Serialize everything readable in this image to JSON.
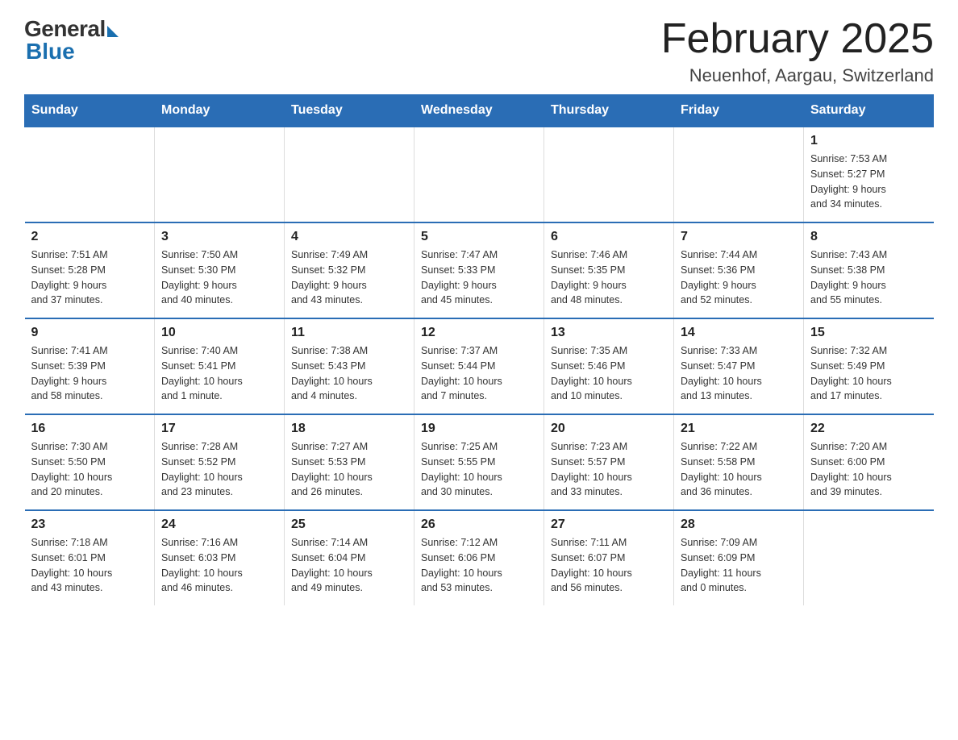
{
  "logo": {
    "general": "General",
    "blue": "Blue"
  },
  "title": "February 2025",
  "subtitle": "Neuenhof, Aargau, Switzerland",
  "days_of_week": [
    "Sunday",
    "Monday",
    "Tuesday",
    "Wednesday",
    "Thursday",
    "Friday",
    "Saturday"
  ],
  "weeks": [
    [
      {
        "day": "",
        "info": ""
      },
      {
        "day": "",
        "info": ""
      },
      {
        "day": "",
        "info": ""
      },
      {
        "day": "",
        "info": ""
      },
      {
        "day": "",
        "info": ""
      },
      {
        "day": "",
        "info": ""
      },
      {
        "day": "1",
        "info": "Sunrise: 7:53 AM\nSunset: 5:27 PM\nDaylight: 9 hours\nand 34 minutes."
      }
    ],
    [
      {
        "day": "2",
        "info": "Sunrise: 7:51 AM\nSunset: 5:28 PM\nDaylight: 9 hours\nand 37 minutes."
      },
      {
        "day": "3",
        "info": "Sunrise: 7:50 AM\nSunset: 5:30 PM\nDaylight: 9 hours\nand 40 minutes."
      },
      {
        "day": "4",
        "info": "Sunrise: 7:49 AM\nSunset: 5:32 PM\nDaylight: 9 hours\nand 43 minutes."
      },
      {
        "day": "5",
        "info": "Sunrise: 7:47 AM\nSunset: 5:33 PM\nDaylight: 9 hours\nand 45 minutes."
      },
      {
        "day": "6",
        "info": "Sunrise: 7:46 AM\nSunset: 5:35 PM\nDaylight: 9 hours\nand 48 minutes."
      },
      {
        "day": "7",
        "info": "Sunrise: 7:44 AM\nSunset: 5:36 PM\nDaylight: 9 hours\nand 52 minutes."
      },
      {
        "day": "8",
        "info": "Sunrise: 7:43 AM\nSunset: 5:38 PM\nDaylight: 9 hours\nand 55 minutes."
      }
    ],
    [
      {
        "day": "9",
        "info": "Sunrise: 7:41 AM\nSunset: 5:39 PM\nDaylight: 9 hours\nand 58 minutes."
      },
      {
        "day": "10",
        "info": "Sunrise: 7:40 AM\nSunset: 5:41 PM\nDaylight: 10 hours\nand 1 minute."
      },
      {
        "day": "11",
        "info": "Sunrise: 7:38 AM\nSunset: 5:43 PM\nDaylight: 10 hours\nand 4 minutes."
      },
      {
        "day": "12",
        "info": "Sunrise: 7:37 AM\nSunset: 5:44 PM\nDaylight: 10 hours\nand 7 minutes."
      },
      {
        "day": "13",
        "info": "Sunrise: 7:35 AM\nSunset: 5:46 PM\nDaylight: 10 hours\nand 10 minutes."
      },
      {
        "day": "14",
        "info": "Sunrise: 7:33 AM\nSunset: 5:47 PM\nDaylight: 10 hours\nand 13 minutes."
      },
      {
        "day": "15",
        "info": "Sunrise: 7:32 AM\nSunset: 5:49 PM\nDaylight: 10 hours\nand 17 minutes."
      }
    ],
    [
      {
        "day": "16",
        "info": "Sunrise: 7:30 AM\nSunset: 5:50 PM\nDaylight: 10 hours\nand 20 minutes."
      },
      {
        "day": "17",
        "info": "Sunrise: 7:28 AM\nSunset: 5:52 PM\nDaylight: 10 hours\nand 23 minutes."
      },
      {
        "day": "18",
        "info": "Sunrise: 7:27 AM\nSunset: 5:53 PM\nDaylight: 10 hours\nand 26 minutes."
      },
      {
        "day": "19",
        "info": "Sunrise: 7:25 AM\nSunset: 5:55 PM\nDaylight: 10 hours\nand 30 minutes."
      },
      {
        "day": "20",
        "info": "Sunrise: 7:23 AM\nSunset: 5:57 PM\nDaylight: 10 hours\nand 33 minutes."
      },
      {
        "day": "21",
        "info": "Sunrise: 7:22 AM\nSunset: 5:58 PM\nDaylight: 10 hours\nand 36 minutes."
      },
      {
        "day": "22",
        "info": "Sunrise: 7:20 AM\nSunset: 6:00 PM\nDaylight: 10 hours\nand 39 minutes."
      }
    ],
    [
      {
        "day": "23",
        "info": "Sunrise: 7:18 AM\nSunset: 6:01 PM\nDaylight: 10 hours\nand 43 minutes."
      },
      {
        "day": "24",
        "info": "Sunrise: 7:16 AM\nSunset: 6:03 PM\nDaylight: 10 hours\nand 46 minutes."
      },
      {
        "day": "25",
        "info": "Sunrise: 7:14 AM\nSunset: 6:04 PM\nDaylight: 10 hours\nand 49 minutes."
      },
      {
        "day": "26",
        "info": "Sunrise: 7:12 AM\nSunset: 6:06 PM\nDaylight: 10 hours\nand 53 minutes."
      },
      {
        "day": "27",
        "info": "Sunrise: 7:11 AM\nSunset: 6:07 PM\nDaylight: 10 hours\nand 56 minutes."
      },
      {
        "day": "28",
        "info": "Sunrise: 7:09 AM\nSunset: 6:09 PM\nDaylight: 11 hours\nand 0 minutes."
      },
      {
        "day": "",
        "info": ""
      }
    ]
  ]
}
